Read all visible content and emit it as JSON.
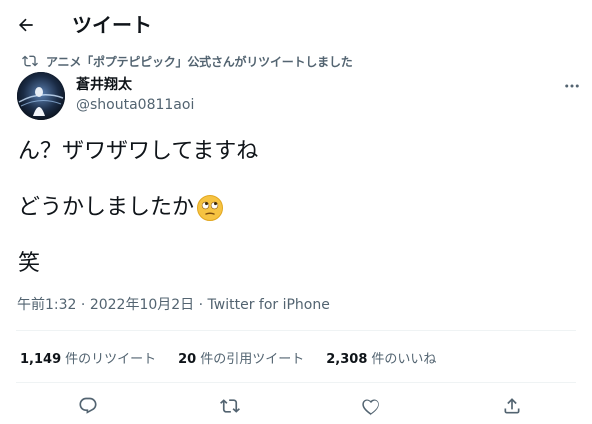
{
  "header": {
    "title": "ツイート"
  },
  "retweet_context": {
    "text": "アニメ「ポプテピピック」公式さんがリツイートしました"
  },
  "tweet": {
    "author": {
      "display_name": "蒼井翔太",
      "handle": "@shouta0811aoi"
    },
    "lines": [
      "ん？ザワザワしてますね",
      "どうかしましたか",
      "笑"
    ],
    "emoji": "eye-roll-face-emoji",
    "time": "午前1:32",
    "separator": " · ",
    "date": "2022年10月2日",
    "client": "Twitter for iPhone"
  },
  "stats": {
    "retweets": {
      "count": "1,149",
      "label": "件のリツイート"
    },
    "quotes": {
      "count": "20",
      "label": "件の引用ツイート"
    },
    "likes": {
      "count": "2,308",
      "label": "件のいいね"
    }
  },
  "icons": {
    "back": "back-arrow-icon",
    "more": "more-dots-icon",
    "reply": "reply-icon",
    "retweet": "retweet-icon",
    "like": "heart-icon",
    "share": "share-icon"
  },
  "colors": {
    "text": "#0f1419",
    "secondary": "#536471",
    "divider": "#eff3f4"
  }
}
